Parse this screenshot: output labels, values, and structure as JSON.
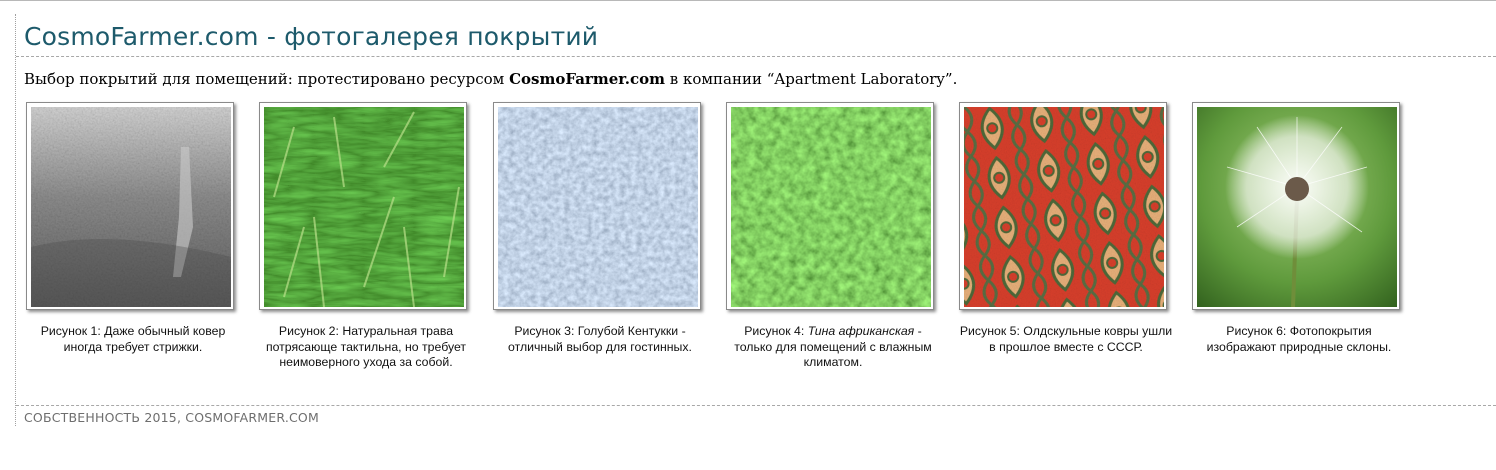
{
  "page": {
    "title": "CosmoFarmer.com - фотогалерея покрытий",
    "intro": {
      "before": "Выбор покрытий для помещений: протестировано ресурсом ",
      "brand": "CosmoFarmer.com",
      "after": " в компании “Apartment Laboratory”."
    },
    "footer": "СОБСТВЕННОСТЬ 2015, COSMOFARMER.COM"
  },
  "gallery": [
    {
      "name": "photo-gray-carpet",
      "caption_pre": "Рисунок 1: Даже обычный ковер иногда требует стрижки.",
      "caption_em": "",
      "caption_post": ""
    },
    {
      "name": "photo-natural-grass",
      "caption_pre": "Рисунок 2: Натуральная трава потрясающе тактильна, но требует неимоверного ухода за собой.",
      "caption_em": "",
      "caption_post": ""
    },
    {
      "name": "photo-blue-kentucky",
      "caption_pre": "Рисунок 3: Голубой Кентукки - отличный выбор для гостинных.",
      "caption_em": "",
      "caption_post": ""
    },
    {
      "name": "photo-african-moss",
      "caption_pre": "Рисунок 4: ",
      "caption_em": "Тина африканская",
      "caption_post": " - только для помещений с влажным климатом."
    },
    {
      "name": "photo-oldschool-rug",
      "caption_pre": "Рисунок 5: Олдскульные ковры ушли в прошлое вместе с СССР.",
      "caption_em": "",
      "caption_post": ""
    },
    {
      "name": "photo-dandelion",
      "caption_pre": "Рисунок 6: Фотопокрытия изображают природные склоны.",
      "caption_em": "",
      "caption_post": ""
    }
  ],
  "colors": {
    "title": "#1d5a6b",
    "footer": "#6e6e6e",
    "rule": "#a8a8a8"
  }
}
